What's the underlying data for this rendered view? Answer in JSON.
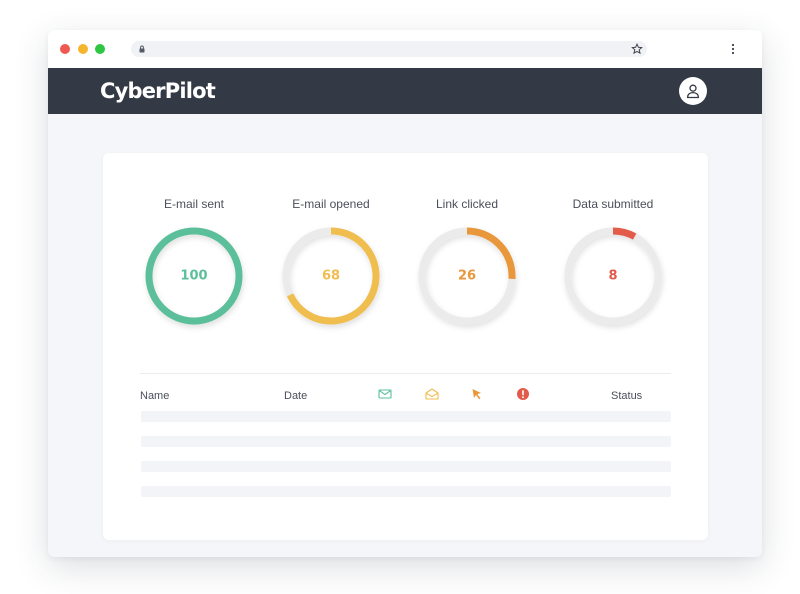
{
  "app": {
    "name": "CyberPilot"
  },
  "stats": [
    {
      "label": "E-mail sent",
      "value": 100,
      "color": "#5bbf9c",
      "icon": "mail-icon"
    },
    {
      "label": "E-mail opened",
      "value": 68,
      "color": "#f0bd4f",
      "icon": "mail-open-icon"
    },
    {
      "label": "Link clicked",
      "value": 26,
      "color": "#e8973a",
      "icon": "cursor-icon"
    },
    {
      "label": "Data submitted",
      "value": 8,
      "color": "#e25b4a",
      "icon": "alert-icon"
    }
  ],
  "table": {
    "columns": {
      "name": "Name",
      "date": "Date",
      "status": "Status"
    },
    "column_icons": [
      "mail-icon",
      "mail-open-icon",
      "cursor-icon",
      "alert-icon"
    ],
    "row_count": 4
  },
  "colors": {
    "appbar": "#343a45",
    "page_background": "#f5f6f9",
    "ring_track": "#ebebeb"
  }
}
